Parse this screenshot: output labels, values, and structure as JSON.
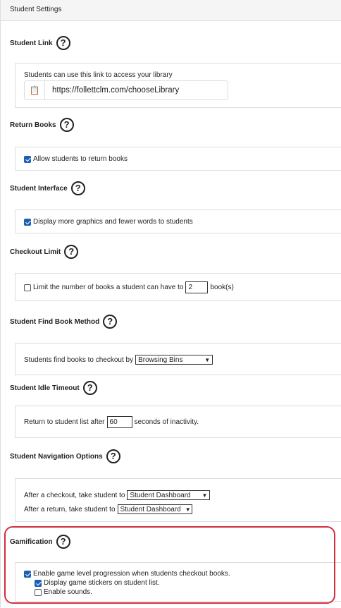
{
  "panel": {
    "title": "Student Settings"
  },
  "student_link": {
    "title": "Student Link",
    "desc": "Students can use this link to access your library",
    "url": "https://follettclm.com/chooseLibrary"
  },
  "return_books": {
    "title": "Return Books",
    "option": "Allow students to return books",
    "checked": true
  },
  "student_interface": {
    "title": "Student Interface",
    "option": "Display more graphics and fewer words to students",
    "checked": true
  },
  "checkout_limit": {
    "title": "Checkout Limit",
    "label_before": "Limit the number of books a student can have to",
    "value": "2",
    "label_after": "book(s)",
    "checked": false
  },
  "find_method": {
    "title": "Student Find Book Method",
    "label": "Students find books to checkout by",
    "selected": "Browsing Bins"
  },
  "idle_timeout": {
    "title": "Student Idle Timeout",
    "label_before": "Return to student list after",
    "value": "60",
    "label_after": "seconds of inactivity."
  },
  "navigation": {
    "title": "Student Navigation Options",
    "checkout_label": "After a checkout, take student to",
    "checkout_selected": "Student Dashboard",
    "return_label": "After a return, take student to",
    "return_selected": "Student Dashboard"
  },
  "gamification": {
    "title": "Gamification",
    "level_progression": "Enable game level progression when students checkout books.",
    "stickers": "Display game stickers on student list.",
    "sounds": "Enable sounds."
  },
  "help_glyph": "?",
  "colors": {
    "checkbox": "#1a5fb4",
    "highlight": "#d32f3f"
  }
}
